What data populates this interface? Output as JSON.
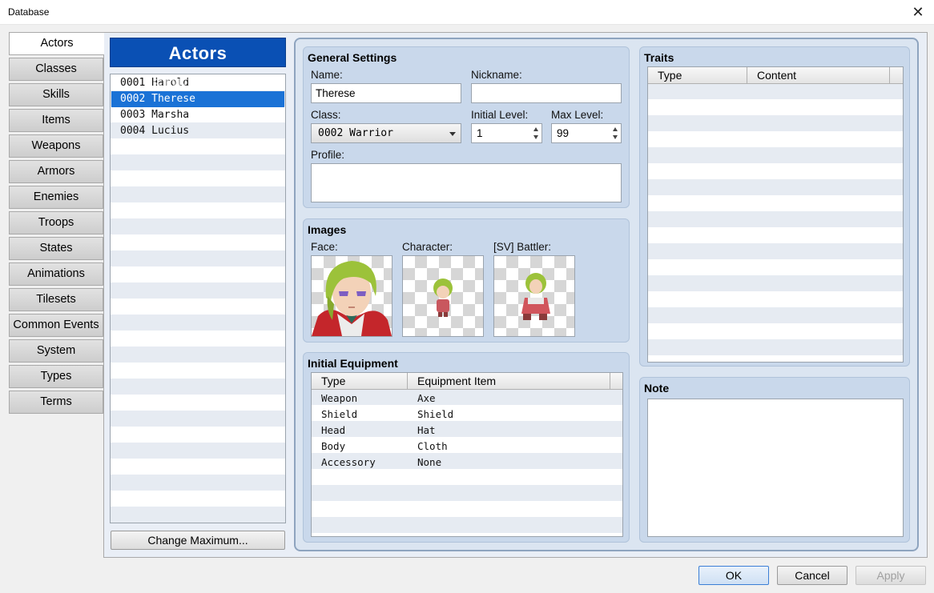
{
  "window": {
    "title": "Database",
    "close_glyph": "✕"
  },
  "categories": [
    "Actors",
    "Classes",
    "Skills",
    "Items",
    "Weapons",
    "Armors",
    "Enemies",
    "Troops",
    "States",
    "Animations",
    "Tilesets",
    "Common Events",
    "System",
    "Types",
    "Terms"
  ],
  "actor_list": {
    "header": "Actors",
    "items": [
      "0001 Harold",
      "0002 Therese",
      "0003 Marsha",
      "0004 Lucius"
    ],
    "selected_index": 1,
    "change_max_label": "Change Maximum..."
  },
  "general": {
    "title": "General Settings",
    "name_label": "Name:",
    "name_value": "Therese",
    "nickname_label": "Nickname:",
    "nickname_value": "",
    "class_label": "Class:",
    "class_value": "0002 Warrior",
    "initial_level_label": "Initial Level:",
    "initial_level_value": "1",
    "max_level_label": "Max Level:",
    "max_level_value": "99",
    "profile_label": "Profile:",
    "profile_value": ""
  },
  "images": {
    "title": "Images",
    "face_label": "Face:",
    "character_label": "Character:",
    "battler_label": "[SV] Battler:"
  },
  "equipment": {
    "title": "Initial Equipment",
    "col_type": "Type",
    "col_item": "Equipment Item",
    "rows": [
      {
        "type": "Weapon",
        "item": "Axe"
      },
      {
        "type": "Shield",
        "item": "Shield"
      },
      {
        "type": "Head",
        "item": "Hat"
      },
      {
        "type": "Body",
        "item": "Cloth"
      },
      {
        "type": "Accessory",
        "item": "None"
      }
    ]
  },
  "traits": {
    "title": "Traits",
    "col_type": "Type",
    "col_content": "Content"
  },
  "note": {
    "title": "Note",
    "value": ""
  },
  "footer": {
    "ok": "OK",
    "cancel": "Cancel",
    "apply": "Apply"
  },
  "watermark": "SOFTPEDIA",
  "colors": {
    "list_header": "#0a50b4",
    "selection": "#1a72d6",
    "panel": "#c9d8eb"
  }
}
